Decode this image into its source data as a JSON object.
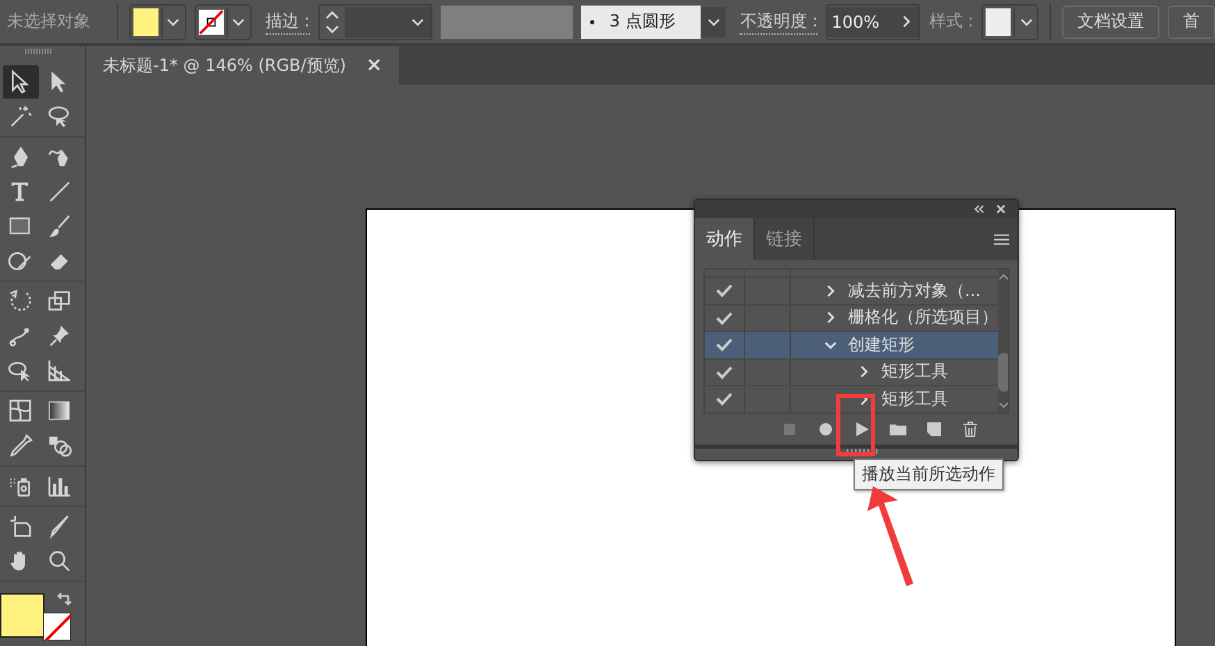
{
  "control_bar": {
    "selection_status": "未选择对象",
    "stroke_label": "描边 :",
    "brush": "3 点圆形",
    "opacity_label": "不透明度 :",
    "opacity": "100%",
    "style_label": "样式 :",
    "buttons": [
      "文档设置",
      "首"
    ]
  },
  "document_tab": {
    "title": "未标题-1* @ 146% (RGB/预览)",
    "close": "×"
  },
  "toolbar": {
    "groups": [
      {
        "tools": [
          {
            "kind": "selection",
            "selected": true
          },
          {
            "kind": "direct",
            "selected": false
          },
          {
            "kind": "wand",
            "selected": false
          },
          {
            "kind": "lasso",
            "selected": false
          }
        ]
      },
      {
        "tools": [
          {
            "kind": "pen",
            "selected": false
          },
          {
            "kind": "curvature",
            "selected": false
          },
          {
            "kind": "type",
            "selected": false
          },
          {
            "kind": "line",
            "selected": false
          },
          {
            "kind": "rect",
            "selected": false
          },
          {
            "kind": "brush",
            "selected": false
          },
          {
            "kind": "shaper",
            "selected": false
          },
          {
            "kind": "eraser",
            "selected": false
          }
        ]
      },
      {
        "tools": [
          {
            "kind": "rotate",
            "selected": false
          },
          {
            "kind": "scale",
            "selected": false
          },
          {
            "kind": "puppet",
            "selected": false
          },
          {
            "kind": "pin",
            "selected": false
          },
          {
            "kind": "freetransform",
            "selected": false
          },
          {
            "kind": "perspective",
            "selected": false
          }
        ]
      },
      {
        "tools": [
          {
            "kind": "mesh",
            "selected": false
          },
          {
            "kind": "gradient",
            "selected": false
          },
          {
            "kind": "eyedropper",
            "selected": false
          },
          {
            "kind": "blend",
            "selected": false
          }
        ]
      },
      {
        "tools": [
          {
            "kind": "symbol",
            "selected": false
          },
          {
            "kind": "graph",
            "selected": false
          }
        ]
      },
      {
        "tools": [
          {
            "kind": "artboard",
            "selected": false
          },
          {
            "kind": "knife",
            "selected": false
          },
          {
            "kind": "hand",
            "selected": false
          },
          {
            "kind": "zoom",
            "selected": false
          }
        ]
      }
    ]
  },
  "actions_panel": {
    "tabs": [
      {
        "label": "动作",
        "selected": true
      },
      {
        "label": "链接",
        "selected": false
      }
    ],
    "rows": [
      {
        "label": "减去前方对象（...",
        "checked": true,
        "expanded": false,
        "selected": false
      },
      {
        "label": "栅格化（所选项目）",
        "checked": true,
        "expanded": false,
        "selected": false
      },
      {
        "label": "创建矩形",
        "checked": true,
        "expanded": true,
        "selected": true,
        "children": [
          {
            "label": "矩形工具",
            "checked": true,
            "expanded": false,
            "selected": false
          },
          {
            "label": "矩形工具",
            "checked": true,
            "expanded": false,
            "selected": false
          }
        ]
      }
    ],
    "tooltip": "播放当前所选动作"
  }
}
